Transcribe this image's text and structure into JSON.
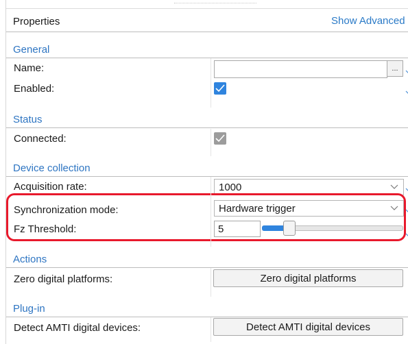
{
  "header": {
    "title": "Properties",
    "show_advanced_link": "Show Advanced"
  },
  "sections": {
    "general": {
      "title": "General",
      "name_label": "Name:",
      "name_value": "",
      "browse_button": "...",
      "enabled_label": "Enabled:",
      "enabled_checked": true
    },
    "status": {
      "title": "Status",
      "connected_label": "Connected:",
      "connected_checked": true
    },
    "device_collection": {
      "title": "Device collection",
      "acquisition_rate_label": "Acquisition rate:",
      "acquisition_rate_value": "1000",
      "sync_mode_label": "Synchronization mode:",
      "sync_mode_value": "Hardware trigger",
      "fz_threshold_label": "Fz Threshold:",
      "fz_threshold_value": "5",
      "fz_threshold_slider_fraction": 0.15
    },
    "actions": {
      "title": "Actions",
      "zero_label": "Zero digital platforms:",
      "zero_button": "Zero digital platforms"
    },
    "plugin": {
      "title": "Plug-in",
      "detect_label": "Detect AMTI digital devices:",
      "detect_button": "Detect AMTI digital devices"
    }
  },
  "colors": {
    "accent": "#2f84de",
    "section_title": "#2e75c2",
    "highlight": "#e8192c"
  }
}
